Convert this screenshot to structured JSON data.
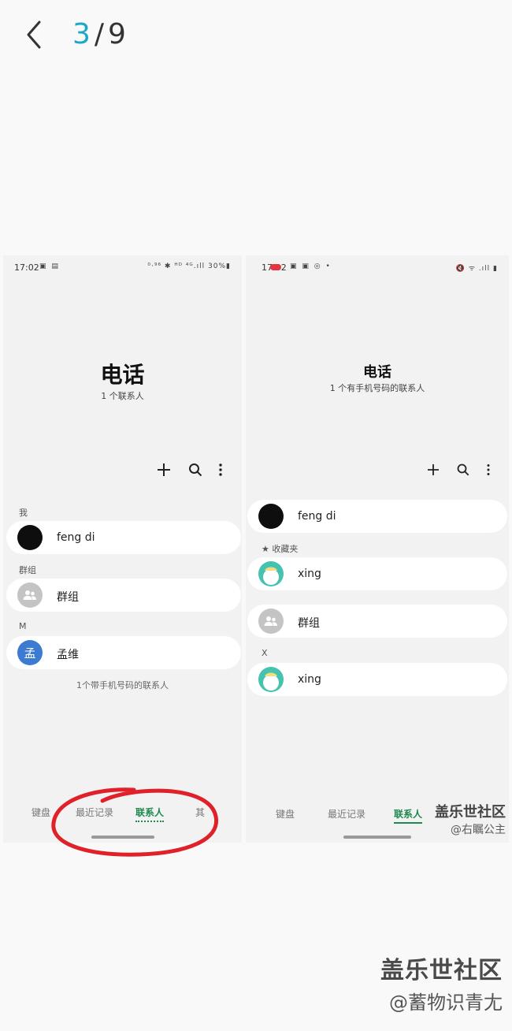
{
  "viewer": {
    "current": "3",
    "separator": "/",
    "total": "9"
  },
  "left_phone": {
    "status": {
      "time": "17:02",
      "right_icons": "⁰·⁹⁶ ✱ ᴴᴰ ⁴ᴳ.ıll 30%▮"
    },
    "app_title": "电话",
    "app_subtitle": "1 个联系人",
    "section_me": "我",
    "me_name": "feng di",
    "section_groups": "群组",
    "group_name": "群组",
    "section_m": "M",
    "contact_avatar_letter": "孟",
    "contact_name": "孟维",
    "footnote": "1个带手机号码的联系人",
    "tabs": [
      "键盘",
      "最近记录",
      "联系人",
      "其"
    ],
    "active_tab": "联系人"
  },
  "right_phone": {
    "status": {
      "time": "17:02",
      "right_icons": "🔇 ᯤ .ıll ▮"
    },
    "app_title": "电话",
    "app_subtitle": "1 个有手机号码的联系人",
    "me_name": "feng di",
    "section_favorites": "收藏夹",
    "favorite_name": "xing",
    "group_name": "群组",
    "section_x": "X",
    "contact_name": "xing",
    "tabs": [
      "键盘",
      "最近记录",
      "联系人"
    ],
    "active_tab": "联系人"
  },
  "watermark_small": {
    "line1": "盖乐世社区",
    "line2": "@右瞩公主"
  },
  "watermark_big": {
    "line1": "盖乐世社区",
    "line2": "@蓄物识青尢"
  },
  "colors": {
    "accent": "#1ba7c9",
    "active_tab": "#1e8a4e",
    "annotation": "#e0212a"
  }
}
